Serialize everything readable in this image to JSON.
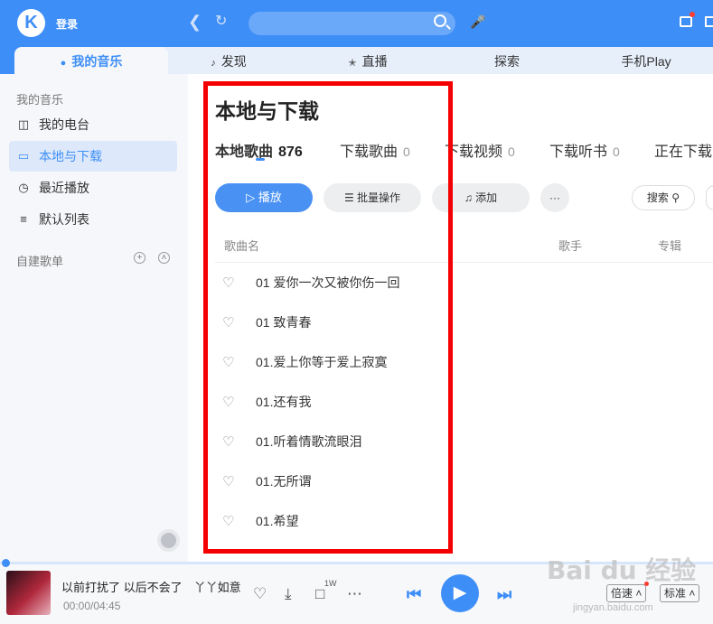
{
  "header": {
    "logo": "K",
    "login": "登录"
  },
  "tabs": [
    {
      "label": "我的音乐"
    },
    {
      "label": "发现"
    },
    {
      "label": "直播"
    },
    {
      "label": "探索"
    },
    {
      "label": "手机Play"
    }
  ],
  "sidebar": {
    "heading": "我的音乐",
    "items": [
      {
        "label": "我的电台",
        "icon": "radio-icon"
      },
      {
        "label": "本地与下载",
        "icon": "computer-icon"
      },
      {
        "label": "最近播放",
        "icon": "clock-icon"
      },
      {
        "label": "默认列表",
        "icon": "list-icon"
      }
    ],
    "playlist_heading": "自建歌单"
  },
  "main": {
    "title": "本地与下载",
    "subtabs": [
      {
        "label": "本地歌曲",
        "count": "876"
      },
      {
        "label": "下载歌曲",
        "count": "0"
      },
      {
        "label": "下载视频",
        "count": "0"
      },
      {
        "label": "下载听书",
        "count": "0"
      },
      {
        "label": "正在下载",
        "count": ""
      }
    ],
    "actions": {
      "play": "播放",
      "batch": "批量操作",
      "add": "添加",
      "more": "···",
      "search": "搜索"
    },
    "columns": {
      "name": "歌曲名",
      "artist": "歌手",
      "album": "专辑"
    },
    "songs": [
      "01 爱你一次又被你伤一回",
      "01 致青春",
      "01.爱上你等于爱上寂寞",
      "01.还有我",
      "01.听着情歌流眼泪",
      "01.无所谓",
      "01.希望"
    ]
  },
  "player": {
    "now_playing": "以前打扰了 以后不会了　丫丫如意",
    "time": "00:00/04:45",
    "comment_count": "1W",
    "speed": "倍速",
    "quality": "标准",
    "progress": 0.0
  },
  "watermark": {
    "brand": "Bai du 经验",
    "url": "jingyan.baidu.com"
  },
  "colors": {
    "accent": "#3e8ef7",
    "highlight_box": "#f40000"
  }
}
